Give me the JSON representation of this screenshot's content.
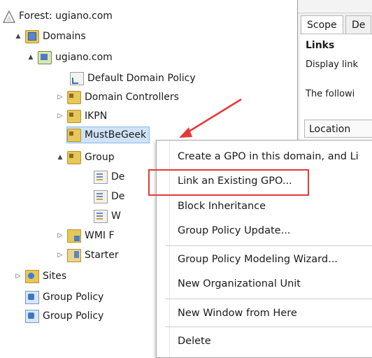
{
  "tree": [
    {
      "label": "Forest: ugiano.com",
      "icon": "forest-icon",
      "expander": "",
      "indent": 0
    },
    {
      "label": "Domains",
      "icon": "domains-folder-icon",
      "expander": "▲",
      "indent": 1
    },
    {
      "label": "ugiano.com",
      "icon": "domain-icon",
      "expander": "▲",
      "indent": 2
    },
    {
      "label": "Default Domain Policy",
      "icon": "gpo-link-icon",
      "expander": "",
      "indent": 3
    },
    {
      "label": "Domain Controllers",
      "icon": "ou-folder-icon",
      "expander": "▷",
      "indent": 3
    },
    {
      "label": "IKPN",
      "icon": "ou-folder-icon",
      "expander": "▷",
      "indent": 3
    },
    {
      "label": "MustBeGeek",
      "icon": "ou-folder-icon",
      "expander": "",
      "indent": 3,
      "selected": true
    },
    {
      "label": "Group",
      "icon": "ou-folder-icon",
      "expander": "▲",
      "indent": 3
    },
    {
      "label": "De",
      "icon": "gpo-icon",
      "expander": "",
      "indent": 4
    },
    {
      "label": "De",
      "icon": "gpo-icon",
      "expander": "",
      "indent": 4
    },
    {
      "label": "W",
      "icon": "gpo-icon",
      "expander": "",
      "indent": 4
    },
    {
      "label": "WMI F",
      "icon": "wmi-filter-icon",
      "expander": "▷",
      "indent": 3
    },
    {
      "label": "Starter",
      "icon": "starter-gpo-icon",
      "expander": "▷",
      "indent": 3
    },
    {
      "label": "Sites",
      "icon": "sites-icon",
      "expander": "▷",
      "indent": 1
    },
    {
      "label": "Group Policy",
      "icon": "gp-modeling-icon",
      "expander": "",
      "indent": 1
    },
    {
      "label": "Group Policy",
      "icon": "gp-results-icon",
      "expander": "",
      "indent": 1
    }
  ],
  "right_panel": {
    "tabs": [
      "Scope",
      "De"
    ],
    "section_title": "Links",
    "display_text": "Display link",
    "following_text": "The followi",
    "column_header": "Location"
  },
  "context_menu": {
    "items": [
      {
        "label": "Create a GPO in this domain, and Li",
        "highlighted": false
      },
      {
        "label": "Link an Existing GPO...",
        "highlighted": true
      },
      {
        "label": "Block Inheritance",
        "highlighted": false
      },
      {
        "label": "Group Policy Update...",
        "highlighted": false
      },
      {
        "label": "Group Policy Modeling Wizard...",
        "highlighted": false
      },
      {
        "label": "New Organizational Unit",
        "highlighted": false
      },
      {
        "label": "New Window from Here",
        "highlighted": false
      },
      {
        "label": "Delete",
        "highlighted": false
      }
    ]
  },
  "annotation": {
    "color": "#e53939"
  },
  "colors": {
    "selection": "#cfe3f8",
    "highlight_border": "#e53939"
  }
}
